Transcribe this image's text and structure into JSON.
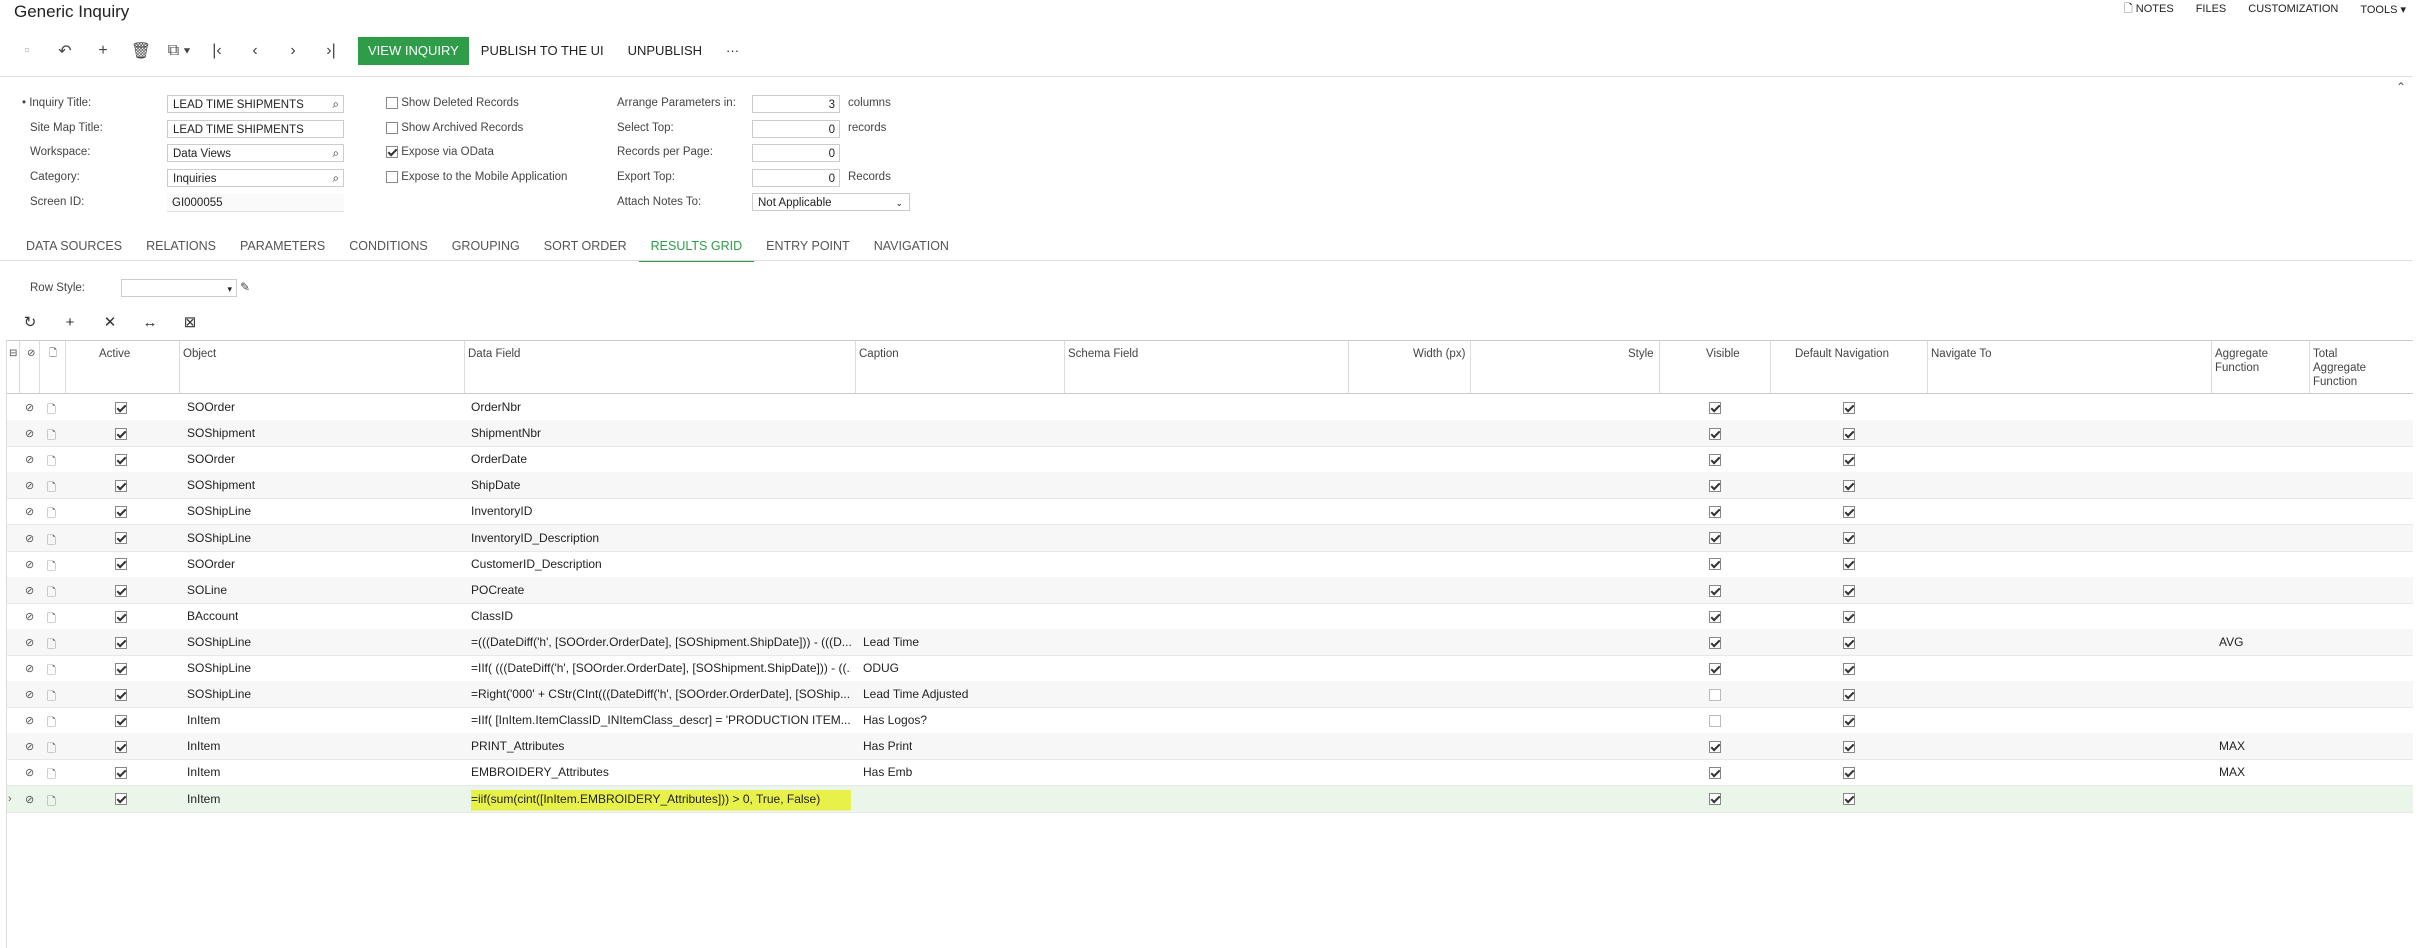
{
  "page": {
    "title": "Generic Inquiry"
  },
  "topmenu": {
    "notes": "NOTES",
    "files": "FILES",
    "customization": "CUSTOMIZATION",
    "tools": "TOOLS"
  },
  "toolbar": {
    "view": "VIEW INQUIRY",
    "publish": "PUBLISH TO THE UI",
    "unpublish": "UNPUBLISH",
    "more": "···"
  },
  "form": {
    "inquiry_title_label": "• Inquiry Title:",
    "inquiry_title": "LEAD TIME SHIPMENTS",
    "sitemap_title_label": "Site Map Title:",
    "sitemap_title": "LEAD TIME SHIPMENTS",
    "workspace_label": "Workspace:",
    "workspace": "Data Views",
    "category_label": "Category:",
    "category": "Inquiries",
    "screen_id_label": "Screen ID:",
    "screen_id": "GI000055",
    "show_deleted": "Show Deleted Records",
    "show_archived": "Show Archived Records",
    "expose_odata": "Expose via OData",
    "expose_mobile": "Expose to the Mobile Application",
    "arrange_label": "Arrange Parameters in:",
    "arrange": "3",
    "arrange_unit": "columns",
    "select_top_label": "Select Top:",
    "select_top": "0",
    "select_top_unit": "records",
    "per_page_label": "Records per Page:",
    "per_page": "0",
    "export_top_label": "Export Top:",
    "export_top": "0",
    "export_top_unit": "Records",
    "attach_notes_label": "Attach Notes To:",
    "attach_notes": "Not Applicable"
  },
  "tabs": [
    "DATA SOURCES",
    "RELATIONS",
    "PARAMETERS",
    "CONDITIONS",
    "GROUPING",
    "SORT ORDER",
    "RESULTS GRID",
    "ENTRY POINT",
    "NAVIGATION"
  ],
  "row_style_label": "Row Style:",
  "grid": {
    "headers": {
      "active": "Active",
      "object": "Object",
      "data_field": "Data Field",
      "caption": "Caption",
      "schema_field": "Schema Field",
      "width": "Width (px)",
      "style": "Style",
      "visible": "Visible",
      "default_nav": "Default Navigation",
      "navigate_to": "Navigate To",
      "agg1": "Aggregate",
      "agg2": "Function",
      "tagg1": "Total",
      "tagg2": "Aggregate",
      "tagg3": "Function"
    },
    "rows": [
      {
        "object": "SOOrder",
        "field": "OrderNbr",
        "caption": "",
        "visible": true,
        "nav": true,
        "agg": ""
      },
      {
        "object": "SOShipment",
        "field": "ShipmentNbr",
        "caption": "",
        "visible": true,
        "nav": true,
        "agg": ""
      },
      {
        "object": "SOOrder",
        "field": "OrderDate",
        "caption": "",
        "visible": true,
        "nav": true,
        "agg": ""
      },
      {
        "object": "SOShipment",
        "field": "ShipDate",
        "caption": "",
        "visible": true,
        "nav": true,
        "agg": ""
      },
      {
        "object": "SOShipLine",
        "field": "InventoryID",
        "caption": "",
        "visible": true,
        "nav": true,
        "agg": ""
      },
      {
        "object": "SOShipLine",
        "field": "InventoryID_Description",
        "caption": "",
        "visible": true,
        "nav": true,
        "agg": ""
      },
      {
        "object": "SOOrder",
        "field": "CustomerID_Description",
        "caption": "",
        "visible": true,
        "nav": true,
        "agg": ""
      },
      {
        "object": "SOLine",
        "field": "POCreate",
        "caption": "",
        "visible": true,
        "nav": true,
        "agg": ""
      },
      {
        "object": "BAccount",
        "field": "ClassID",
        "caption": "",
        "visible": true,
        "nav": true,
        "agg": ""
      },
      {
        "object": "SOShipLine",
        "field": "=(((DateDiff('h', [SOOrder.OrderDate], [SOShipment.ShipDate])) - (((D...",
        "caption": "Lead Time",
        "visible": true,
        "nav": true,
        "agg": "AVG"
      },
      {
        "object": "SOShipLine",
        "field": "=IIf( (((DateDiff('h', [SOOrder.OrderDate], [SOShipment.ShipDate])) - ((...",
        "caption": "ODUG",
        "visible": true,
        "nav": true,
        "agg": ""
      },
      {
        "object": "SOShipLine",
        "field": "=Right('000' + CStr(CInt(((DateDiff('h', [SOOrder.OrderDate], [SOShip...",
        "caption": "Lead Time Adjusted",
        "visible": false,
        "nav": true,
        "agg": ""
      },
      {
        "object": "InItem",
        "field": "=IIf( [InItem.ItemClassID_INItemClass_descr] = 'PRODUCTION ITEM...",
        "caption": "Has Logos?",
        "visible": false,
        "nav": true,
        "agg": ""
      },
      {
        "object": "InItem",
        "field": "PRINT_Attributes",
        "caption": "Has Print",
        "visible": true,
        "nav": true,
        "agg": "MAX"
      },
      {
        "object": "InItem",
        "field": "EMBROIDERY_Attributes",
        "caption": "Has Emb",
        "visible": true,
        "nav": true,
        "agg": "MAX"
      },
      {
        "object": "InItem",
        "field": "=iif(sum(cint([InItem.EMBROIDERY_Attributes])) > 0, True, False)",
        "caption": "",
        "visible": true,
        "nav": true,
        "agg": ""
      }
    ]
  }
}
